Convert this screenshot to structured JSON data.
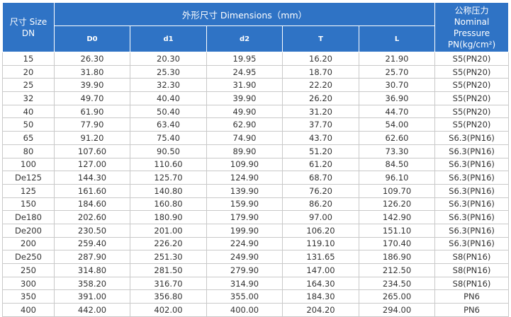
{
  "header": {
    "size_line1": "尺寸 Size",
    "size_line2": "DN",
    "dimensions": "外形尺寸 Dimensions（mm）",
    "pressure_line1": "公称压力",
    "pressure_line2": "Nominal Pressure",
    "pressure_line3": "PN(kg/cm²)",
    "columns": [
      "D0",
      "d1",
      "d2",
      "T",
      "L"
    ]
  },
  "rows": [
    [
      "15",
      "26.30",
      "20.30",
      "19.95",
      "16.20",
      "21.90",
      "S5(PN20)"
    ],
    [
      "20",
      "31.80",
      "25.30",
      "24.95",
      "18.70",
      "25.70",
      "S5(PN20)"
    ],
    [
      "25",
      "39.90",
      "32.30",
      "31.90",
      "22.20",
      "30.70",
      "S5(PN20)"
    ],
    [
      "32",
      "49.70",
      "40.40",
      "39.90",
      "26.20",
      "36.90",
      "S5(PN20)"
    ],
    [
      "40",
      "61.90",
      "50.40",
      "49.90",
      "31.20",
      "44.70",
      "S5(PN20)"
    ],
    [
      "50",
      "77.90",
      "63.40",
      "62.90",
      "37.70",
      "54.00",
      "S5(PN20)"
    ],
    [
      "65",
      "91.20",
      "75.40",
      "74.90",
      "43.70",
      "62.60",
      "S6.3(PN16)"
    ],
    [
      "80",
      "107.60",
      "90.50",
      "89.90",
      "51.20",
      "73.30",
      "S6.3(PN16)"
    ],
    [
      "100",
      "127.00",
      "110.60",
      "109.90",
      "61.20",
      "84.50",
      "S6.3(PN16)"
    ],
    [
      "De125",
      "144.30",
      "125.70",
      "124.90",
      "68.70",
      "96.10",
      "S6.3(PN16)"
    ],
    [
      "125",
      "161.60",
      "140.80",
      "139.90",
      "76.20",
      "109.70",
      "S6.3(PN16)"
    ],
    [
      "150",
      "184.60",
      "160.80",
      "159.90",
      "86.20",
      "126.20",
      "S6.3(PN16)"
    ],
    [
      "De180",
      "202.60",
      "180.90",
      "179.90",
      "97.00",
      "142.90",
      "S6.3(PN16)"
    ],
    [
      "De200",
      "230.50",
      "201.00",
      "199.90",
      "106.20",
      "151.10",
      "S6.3(PN16)"
    ],
    [
      "200",
      "259.40",
      "226.20",
      "224.90",
      "119.10",
      "170.40",
      "S6.3(PN16)"
    ],
    [
      "De250",
      "287.90",
      "251.30",
      "249.90",
      "131.65",
      "186.90",
      "S8(PN16)"
    ],
    [
      "250",
      "314.80",
      "281.50",
      "279.90",
      "147.00",
      "212.50",
      "S8(PN16)"
    ],
    [
      "300",
      "358.20",
      "316.70",
      "314.90",
      "164.30",
      "234.50",
      "S8(PN16)"
    ],
    [
      "350",
      "391.00",
      "356.80",
      "355.00",
      "184.30",
      "265.00",
      "PN6"
    ],
    [
      "400",
      "442.00",
      "402.00",
      "400.00",
      "204.20",
      "294.00",
      "PN6"
    ]
  ]
}
